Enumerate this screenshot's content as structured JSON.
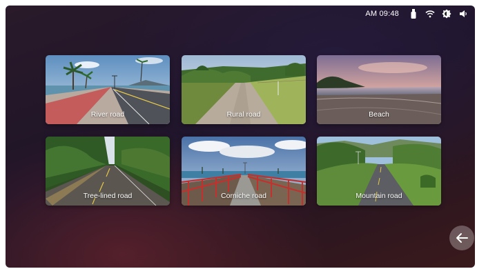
{
  "status": {
    "time": "AM 09:48",
    "icons": [
      "usb-icon",
      "wifi-icon",
      "brightness-icon",
      "volume-icon"
    ]
  },
  "routes": [
    {
      "label": "River road"
    },
    {
      "label": "Rural road"
    },
    {
      "label": "Beach"
    },
    {
      "label": "Tree-lined road"
    },
    {
      "label": "Corniche road"
    },
    {
      "label": "Mountain road"
    }
  ],
  "back_icon": "arrow-left-icon"
}
